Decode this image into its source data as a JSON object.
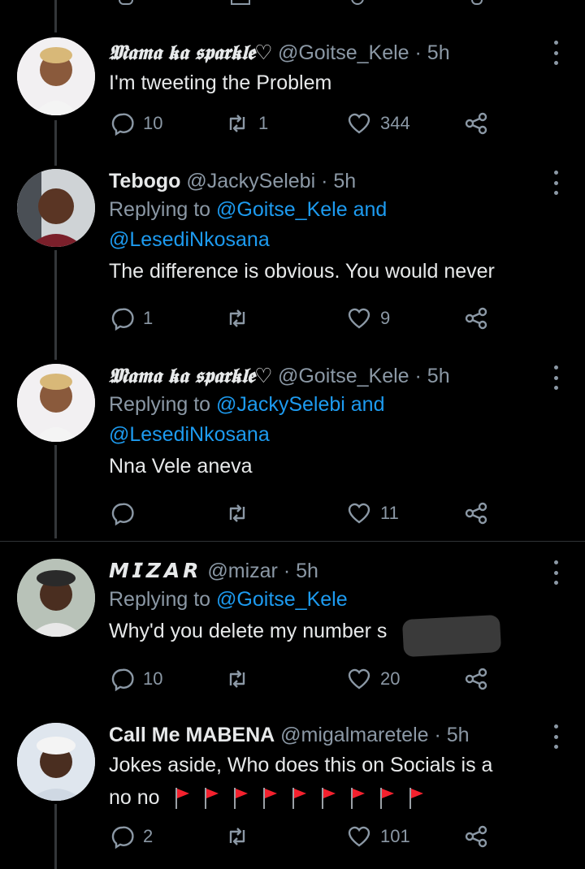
{
  "colors": {
    "background": "#000000",
    "text": "#e7e9ea",
    "muted": "#8b98a5",
    "link": "#1d9bf0",
    "flag": "#f4212e"
  },
  "tweets": [
    {
      "name": "𝕸𝖆𝖒𝖆 𝖐𝖆 𝖘𝖕𝖆𝖗𝖐𝖑𝖊♡",
      "handle": "@Goitse_Kele",
      "time": "· 5h",
      "reply_prefix": "",
      "reply_to": [],
      "text": "I'm tweeting the Problem",
      "replies": "10",
      "retweets": "1",
      "likes": "344"
    },
    {
      "name": "Tebogo",
      "handle": "@JackySelebi",
      "time": "· 5h",
      "reply_prefix": "Replying to",
      "reply_to": [
        "@Goitse_Kele",
        "and",
        "@LesediNkosana"
      ],
      "text": "The difference is obvious.  You would never",
      "replies": "1",
      "retweets": "",
      "likes": "9"
    },
    {
      "name": "𝕸𝖆𝖒𝖆 𝖐𝖆 𝖘𝖕𝖆𝖗𝖐𝖑𝖊♡",
      "handle": "@Goitse_Kele",
      "time": "· 5h",
      "reply_prefix": "Replying to",
      "reply_to": [
        "@JackySelebi",
        "and",
        "@LesediNkosana"
      ],
      "text": "Nna Vele aneva",
      "replies": "",
      "retweets": "",
      "likes": "11"
    },
    {
      "name": "𝙈𝙄𝙕𝘼𝙍",
      "handle": "@mizar",
      "time": "· 5h",
      "reply_prefix": "Replying to",
      "reply_to": [
        "@Goitse_Kele"
      ],
      "text": "Why'd you delete my number s",
      "text_tail": "'",
      "replies": "10",
      "retweets": "",
      "likes": "20"
    },
    {
      "name": "Call Me MABENA",
      "handle": "@migalmaretele",
      "time": "· 5h",
      "reply_prefix": "",
      "reply_to": [],
      "text": "Jokes aside, Who does this on Socials is a",
      "text_line2": "no no",
      "flag_count": 9,
      "replies": "2",
      "retweets": "",
      "likes": "101"
    }
  ]
}
